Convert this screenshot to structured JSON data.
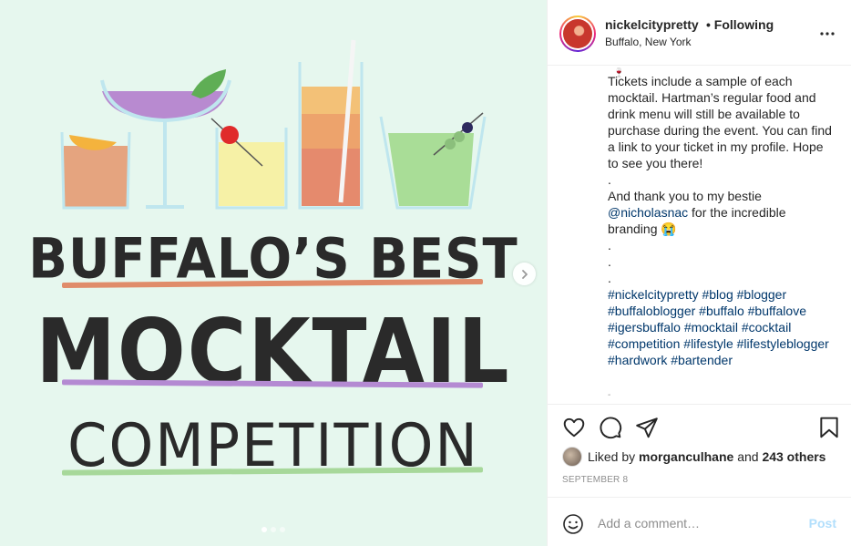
{
  "media": {
    "title_line1": "BUFFALO’S BEST",
    "title_line2": "MOCKTAIL",
    "title_line3": "COMPETITION",
    "background_color": "#e6f7ee",
    "carousel_dots": 3,
    "active_dot": 0,
    "next_icon": "chevron-right-icon"
  },
  "header": {
    "username": "nickelcitypretty",
    "separator": "•",
    "follow_status": "Following",
    "location": "Buffalo, New York",
    "more_icon": "more-horizontal-icon"
  },
  "caption": {
    "top_emoji": "🍷",
    "paragraph1": "Tickets include a sample of each mocktail. Hartman’s regular food and drink menu will still be available to purchase during the event. You can find a link to your ticket in my profile. Hope to see you there!",
    "dot1": ".",
    "thanks_prefix": "And thank you to my bestie ",
    "mention": "@nicholasnac",
    "thanks_suffix": " for the incredible branding 😭",
    "dot2": ".",
    "dot3": ".",
    "dot4": ".",
    "hashtags": [
      "#nickelcitypretty",
      "#blog",
      "#blogger",
      "#buffaloblogger",
      "#buffalo",
      "#buffalove",
      "#igersbuffalo",
      "#mocktail",
      "#cocktail",
      "#competition",
      "#lifestyle",
      "#lifestyleblogger",
      "#hardwork",
      "#bartender"
    ]
  },
  "actions": {
    "like_icon": "heart-icon",
    "comment_icon": "comment-icon",
    "share_icon": "paper-plane-icon",
    "save_icon": "bookmark-icon"
  },
  "likes": {
    "prefix": "Liked by",
    "user": "morganculhane",
    "middle": "and",
    "count": "243 others"
  },
  "date": "SEPTEMBER 8",
  "comment": {
    "placeholder": "Add a comment…",
    "post_label": "Post",
    "emoji_icon": "smiley-icon"
  }
}
